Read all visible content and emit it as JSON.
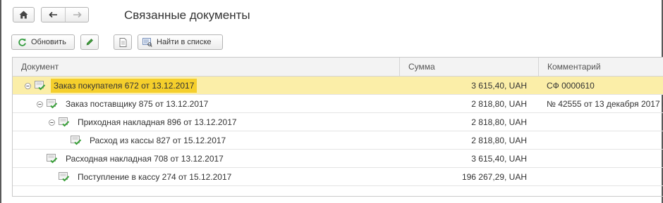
{
  "window": {
    "title": "Связанные документы"
  },
  "toolbar": {
    "refresh_label": "Обновить",
    "find_label": "Найти в списке"
  },
  "table": {
    "columns": [
      "Документ",
      "Сумма",
      "Комментарий"
    ],
    "rows": [
      {
        "document": "Заказ покупателя 672 от 13.12.2017",
        "sum": "3 615,40, UAH",
        "comment": "СФ 0000610",
        "level": 0,
        "expandable": true,
        "selected": true
      },
      {
        "document": "Заказ поставщику 875 от 13.12.2017",
        "sum": "2 818,80, UAH",
        "comment": "№ 42555 от 13 декабря 2017 г.",
        "level": 1,
        "expandable": true,
        "selected": false
      },
      {
        "document": "Приходная накладная 896 от 13.12.2017",
        "sum": "2 818,80, UAH",
        "comment": "",
        "level": 2,
        "expandable": true,
        "selected": false
      },
      {
        "document": "Расход из кассы 827 от 15.12.2017",
        "sum": "2 818,80, UAH",
        "comment": "",
        "level": 3,
        "expandable": false,
        "selected": false
      },
      {
        "document": "Расходная накладная 708 от 13.12.2017",
        "sum": "3 615,40, UAH",
        "comment": "",
        "level": 1,
        "expandable": false,
        "selected": false
      },
      {
        "document": "Поступление в кассу 274 от 15.12.2017",
        "sum": "196 267,29, UAH",
        "comment": "",
        "level": 2,
        "expandable": false,
        "selected": false
      }
    ]
  },
  "colors": {
    "selected_row": "#fbeea8",
    "selected_highlight": "#f5cf2c",
    "doc_icon_green": "#4caf50"
  },
  "icons": {
    "home": "home-icon",
    "back": "arrow-left-icon",
    "forward": "arrow-right-icon",
    "refresh": "refresh-icon",
    "edit": "pencil-icon",
    "doc": "document-icon",
    "find": "find-in-list-icon",
    "expander": "collapse-icon",
    "row_doc": "document-posted-icon"
  }
}
